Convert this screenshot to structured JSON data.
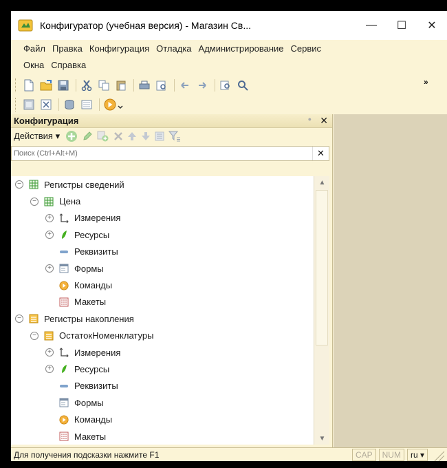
{
  "window": {
    "title": "Конфигуратор (учебная версия) - Магазин Св...",
    "controls": {
      "minimize": "—",
      "maximize": "☐",
      "close": "✕"
    }
  },
  "menu": {
    "row1": [
      "Файл",
      "Правка",
      "Конфигурация",
      "Отладка",
      "Администрирование",
      "Сервис"
    ],
    "row2": [
      "Окна",
      "Справка"
    ]
  },
  "toolbar": {
    "overflow": "»"
  },
  "panel": {
    "title": "Конфигурация",
    "close": "✕",
    "actions_label": "Действия ▾",
    "search_placeholder": "Поиск (Ctrl+Alt+M)",
    "search_clear": "✕"
  },
  "tree": [
    {
      "label": "Регистры сведений",
      "indent": 0,
      "expander": "⊖",
      "icon": "table-green-icon"
    },
    {
      "label": "Цена",
      "indent": 1,
      "expander": "⊖",
      "icon": "table-green-icon"
    },
    {
      "label": "Измерения",
      "indent": 2,
      "expander": "⊕",
      "icon": "axis-icon"
    },
    {
      "label": "Ресурсы",
      "indent": 2,
      "expander": "⊕",
      "icon": "leaf-icon"
    },
    {
      "label": "Реквизиты",
      "indent": 2,
      "expander": "",
      "icon": "dash-icon"
    },
    {
      "label": "Формы",
      "indent": 2,
      "expander": "⊕",
      "icon": "form-icon"
    },
    {
      "label": "Команды",
      "indent": 2,
      "expander": "",
      "icon": "play-icon"
    },
    {
      "label": "Макеты",
      "indent": 2,
      "expander": "",
      "icon": "layout-icon"
    },
    {
      "label": "Регистры накопления",
      "indent": 0,
      "expander": "⊖",
      "icon": "register-icon"
    },
    {
      "label": "ОстатокНоменклатуры",
      "indent": 1,
      "expander": "⊖",
      "icon": "register-icon"
    },
    {
      "label": "Измерения",
      "indent": 2,
      "expander": "⊕",
      "icon": "axis-icon"
    },
    {
      "label": "Ресурсы",
      "indent": 2,
      "expander": "⊕",
      "icon": "leaf-icon"
    },
    {
      "label": "Реквизиты",
      "indent": 2,
      "expander": "",
      "icon": "dash-icon"
    },
    {
      "label": "Формы",
      "indent": 2,
      "expander": "",
      "icon": "form-icon"
    },
    {
      "label": "Команды",
      "indent": 2,
      "expander": "",
      "icon": "play-icon"
    },
    {
      "label": "Макеты",
      "indent": 2,
      "expander": "",
      "icon": "layout-icon"
    }
  ],
  "scrollbar": {
    "up": "▲",
    "down": "▼"
  },
  "status": {
    "hint": "Для получения подсказки нажмите F1",
    "cap": "CAP",
    "num": "NUM",
    "lang": "ru ▾"
  },
  "colors": {
    "background": "#fbf4d6",
    "workarea": "#dcd3b8",
    "accent_green": "#37a132",
    "accent_orange": "#f0a020"
  }
}
